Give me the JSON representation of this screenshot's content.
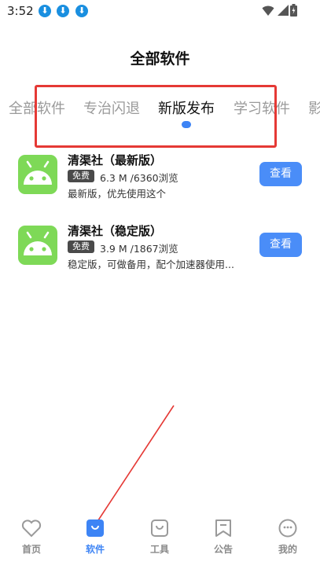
{
  "status_bar": {
    "time": "3:52",
    "notification_icons": [
      "download-icon",
      "download-icon",
      "download-icon"
    ],
    "right_icons": [
      "wifi-icon",
      "signal-icon",
      "battery-icon"
    ]
  },
  "page": {
    "title": "全部软件"
  },
  "tabs": [
    {
      "label": "全部软件",
      "active": false
    },
    {
      "label": "专治闪退",
      "active": false
    },
    {
      "label": "新版发布",
      "active": true
    },
    {
      "label": "学习软件",
      "active": false
    },
    {
      "label": "影",
      "active": false
    }
  ],
  "items": [
    {
      "title": "清渠社（最新版）",
      "badge": "免费",
      "stats": "6.3 M /6360浏览",
      "desc": "最新版，优先使用这个",
      "button": "查看",
      "icon": "android-icon"
    },
    {
      "title": "清渠社（稳定版）",
      "badge": "免费",
      "stats": "3.9 M /1867浏览",
      "desc": "稳定版，可做备用，配个加速器使用...",
      "button": "查看",
      "icon": "android-icon"
    }
  ],
  "bottom_nav": [
    {
      "label": "首页",
      "icon": "heart-icon",
      "active": false
    },
    {
      "label": "软件",
      "icon": "bag-icon",
      "active": true
    },
    {
      "label": "工具",
      "icon": "bag-outline-icon",
      "active": false
    },
    {
      "label": "公告",
      "icon": "bookmark-icon",
      "active": false
    },
    {
      "label": "我的",
      "icon": "face-icon",
      "active": false
    }
  ],
  "colors": {
    "accent": "#3d84f5",
    "button": "#4a8df8",
    "app_icon": "#7ed957",
    "highlight": "#e53935"
  }
}
